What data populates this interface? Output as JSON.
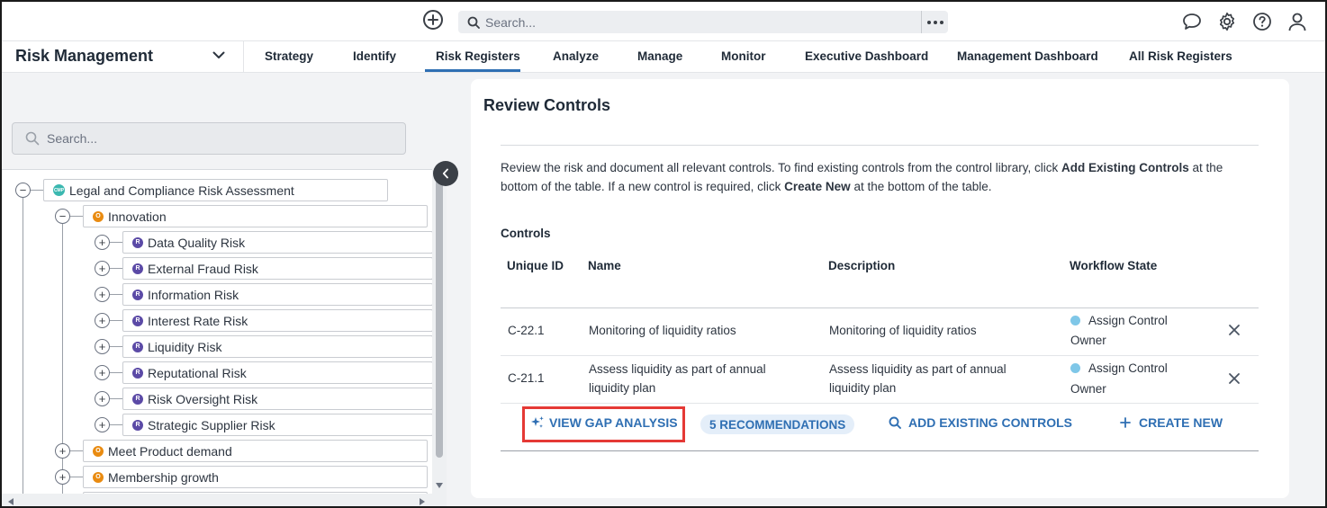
{
  "topbar": {
    "search_placeholder": "Search...",
    "icons": [
      "add-icon",
      "search-icon",
      "more-icon",
      "chat-icon",
      "settings-icon",
      "help-icon",
      "user-icon"
    ]
  },
  "nav": {
    "app_title": "Risk Management",
    "tabs": [
      "Strategy",
      "Identify",
      "Risk Registers",
      "Analyze",
      "Manage",
      "Monitor",
      "Executive Dashboard",
      "Management Dashboard",
      "All Risk Registers"
    ],
    "active_tab": "Risk Registers"
  },
  "tree": {
    "search_placeholder": "Search...",
    "root": {
      "badge": "CMP",
      "label": "Legal and Compliance Risk Assessment"
    },
    "objective": {
      "badge": "O",
      "label": "Innovation"
    },
    "risks": [
      {
        "badge": "R",
        "label": "Data Quality Risk"
      },
      {
        "badge": "R",
        "label": "External Fraud Risk"
      },
      {
        "badge": "R",
        "label": "Information Risk"
      },
      {
        "badge": "R",
        "label": "Interest Rate Risk"
      },
      {
        "badge": "R",
        "label": "Liquidity Risk"
      },
      {
        "badge": "R",
        "label": "Reputational Risk"
      },
      {
        "badge": "R",
        "label": "Risk Oversight Risk"
      },
      {
        "badge": "R",
        "label": "Strategic Supplier Risk"
      }
    ],
    "siblings": [
      {
        "badge": "O",
        "label": "Meet Product demand"
      },
      {
        "badge": "O",
        "label": "Membership growth"
      }
    ]
  },
  "card": {
    "title": "Review Controls",
    "desc_1": "Review the risk and document all relevant controls. To find existing controls from the control library, click ",
    "desc_bold_1": "Add Existing Controls",
    "desc_2": " at the bottom of the table. If a new control is required, click ",
    "desc_bold_2": "Create New",
    "desc_3": " at the bottom of the table.",
    "controls_label": "Controls",
    "columns": [
      "Unique ID",
      "Name",
      "Description",
      "Workflow State"
    ],
    "rows": [
      {
        "id": "C-22.1",
        "name": "Monitoring of liquidity ratios",
        "description": "Monitoring of liquidity ratios",
        "state_1": "Assign Control",
        "state_2": "Owner"
      },
      {
        "id": "C-21.1",
        "name_1": "Assess liquidity as part of annual",
        "name_2": "liquidity plan",
        "description_1": "Assess liquidity as part of annual",
        "description_2": "liquidity plan",
        "state_1": "Assign Control",
        "state_2": "Owner"
      }
    ],
    "actions": {
      "gap": "VIEW GAP ANALYSIS",
      "recommendations": "5 RECOMMENDATIONS",
      "add_existing": "ADD EXISTING CONTROLS",
      "create_new": "CREATE NEW"
    }
  }
}
